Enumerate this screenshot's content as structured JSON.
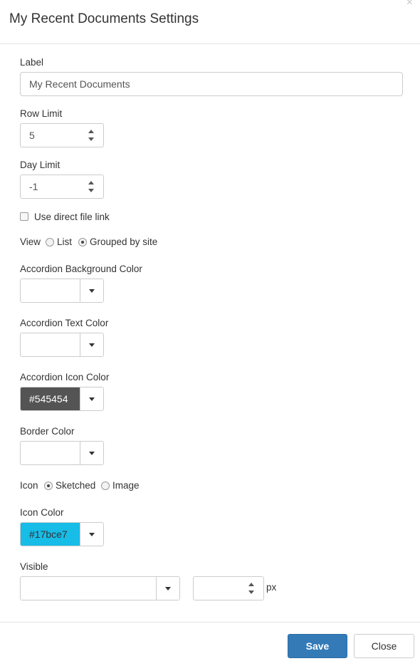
{
  "dialog": {
    "title": "My Recent Documents Settings",
    "close_glyph": "×"
  },
  "form": {
    "label": {
      "label": "Label",
      "value": "My Recent Documents"
    },
    "row_limit": {
      "label": "Row Limit",
      "value": "5"
    },
    "day_limit": {
      "label": "Day Limit",
      "value": "-1"
    },
    "direct_link": {
      "label": "Use direct file link",
      "checked": false
    },
    "view": {
      "label": "View",
      "options": [
        "List",
        "Grouped by site"
      ],
      "selected": "Grouped by site"
    },
    "accordion_bg": {
      "label": "Accordion Background Color",
      "value": ""
    },
    "accordion_text": {
      "label": "Accordion Text Color",
      "value": ""
    },
    "accordion_icon": {
      "label": "Accordion Icon Color",
      "value": "#545454"
    },
    "border_color": {
      "label": "Border Color",
      "value": ""
    },
    "icon": {
      "label": "Icon",
      "options": [
        "Sketched",
        "Image"
      ],
      "selected": "Sketched"
    },
    "icon_color": {
      "label": "Icon Color",
      "value": "#17bce7"
    },
    "visible": {
      "label": "Visible",
      "select_value": "",
      "px_value": "",
      "unit": "px"
    }
  },
  "footer": {
    "save_label": "Save",
    "close_label": "Close"
  },
  "colors": {
    "primary": "#337ab7",
    "accordion_icon_swatch": "#545454",
    "icon_color_swatch": "#17bce7"
  }
}
